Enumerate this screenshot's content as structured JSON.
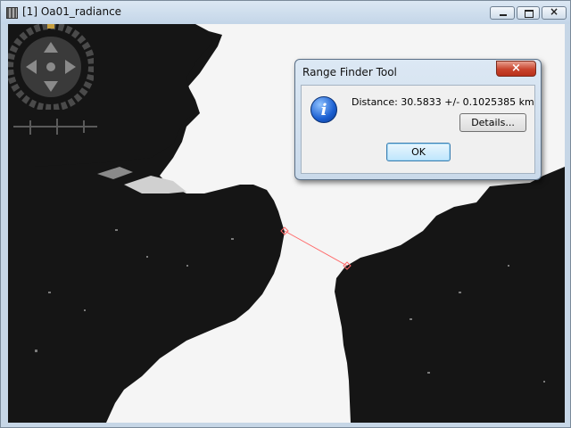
{
  "window": {
    "title": "[1] Oa01_radiance"
  },
  "dialog": {
    "title": "Range Finder Tool",
    "message": "Distance: 30.5833 +/- 0.1025385 km",
    "details_label": "Details...",
    "ok_label": "OK",
    "close_glyph": "×",
    "icon": "information-icon",
    "icon_glyph": "i"
  },
  "icons": {
    "minimize": "minimize-icon",
    "maximize": "maximize-icon",
    "close": "close-icon"
  }
}
